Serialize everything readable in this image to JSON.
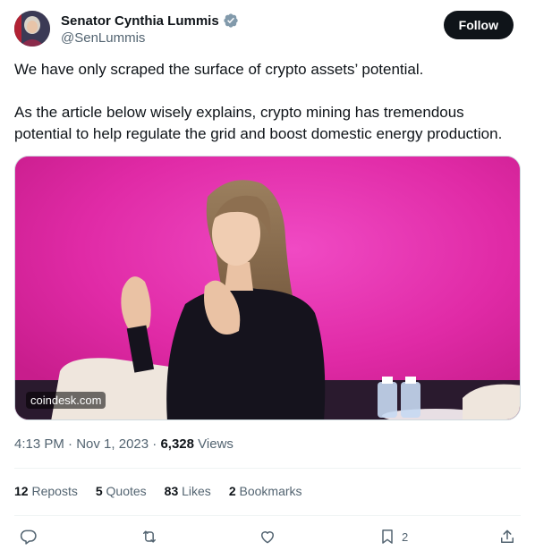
{
  "author": {
    "display_name": "Senator Cynthia Lummis",
    "handle": "@SenLummis",
    "verified_icon": "verified-badge-icon",
    "follow_label": "Follow"
  },
  "tweet": {
    "paragraph1": "We have only scraped the surface of crypto assets’ potential.",
    "paragraph2": "As the article below wisely explains, crypto mining has tremendous potential to help regulate the grid and boost domestic energy production."
  },
  "media": {
    "source_label": "coindesk.com"
  },
  "meta": {
    "time": "4:13 PM",
    "separator": " · ",
    "date": "Nov 1, 2023",
    "separator2": " · ",
    "views_count": "6,328",
    "views_label": "Views"
  },
  "stats": {
    "reposts_count": "12",
    "reposts_label": "Reposts",
    "quotes_count": "5",
    "quotes_label": "Quotes",
    "likes_count": "83",
    "likes_label": "Likes",
    "bookmarks_count": "2",
    "bookmarks_label": "Bookmarks"
  },
  "actions": {
    "reply_icon": "reply-icon",
    "repost_icon": "repost-icon",
    "like_icon": "heart-icon",
    "bookmark_icon": "bookmark-icon",
    "bookmark_count": "2",
    "share_icon": "share-icon"
  },
  "colors": {
    "brand_text": "#0f1419",
    "secondary_text": "#536471",
    "verified_badge": "#829aab",
    "media_background": "#e0299f"
  }
}
